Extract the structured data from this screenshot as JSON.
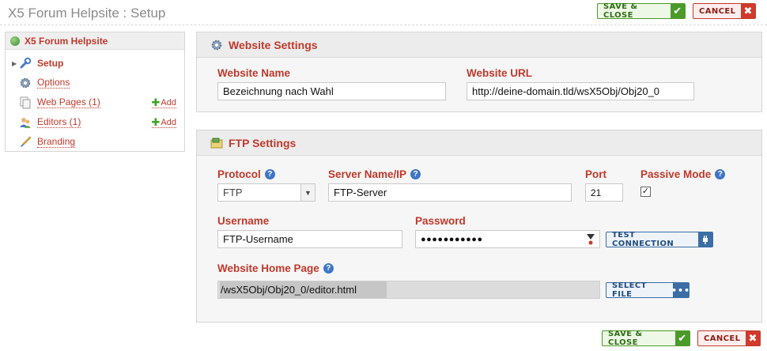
{
  "window": {
    "title": "X5 Forum Helpsite : Setup"
  },
  "actions": {
    "save_label": "SAVE & CLOSE",
    "cancel_label": "CANCEL"
  },
  "sidebar": {
    "root": "X5 Forum Helpsite",
    "items": [
      {
        "label": "Setup",
        "icon": "wrench-icon"
      },
      {
        "label": "Options",
        "icon": "gear-icon"
      },
      {
        "label": "Web Pages (1)",
        "icon": "pages-icon",
        "add": "Add"
      },
      {
        "label": "Editors (1)",
        "icon": "users-icon",
        "add": "Add"
      },
      {
        "label": "Branding",
        "icon": "brush-icon"
      }
    ]
  },
  "website": {
    "heading": "Website Settings",
    "name_label": "Website Name",
    "name_value": "Bezeichnung nach Wahl",
    "url_label": "Website URL",
    "url_value": "http://deine-domain.tld/wsX5Obj/Obj20_0"
  },
  "ftp": {
    "heading": "FTP Settings",
    "protocol_label": "Protocol",
    "protocol_value": "FTP",
    "server_label": "Server Name/IP",
    "server_value": "FTP-Server",
    "port_label": "Port",
    "port_value": "21",
    "passive_label": "Passive Mode",
    "passive_checked": true,
    "username_label": "Username",
    "username_value": "FTP-Username",
    "password_label": "Password",
    "password_mask": "●●●●●●●●●●●",
    "test_label": "TEST CONNECTION",
    "home_label": "Website Home Page",
    "home_value": "/wsX5Obj/Obj20_0/editor.html",
    "select_label": "SELECT FILE"
  },
  "colors": {
    "accent": "#c0392b",
    "save": "#4c9a2a",
    "link_blue": "#3a6ea5"
  }
}
